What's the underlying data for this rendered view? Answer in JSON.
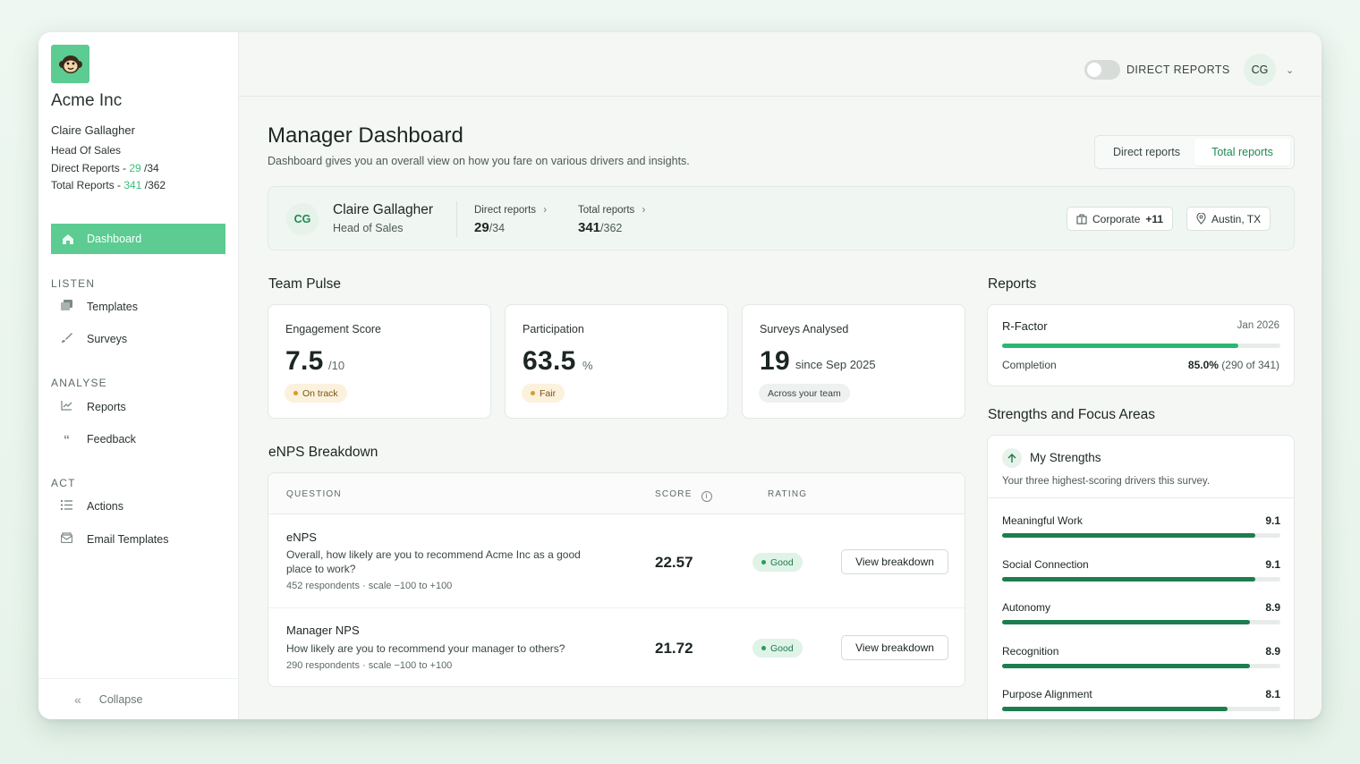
{
  "sidebar": {
    "company": "Acme Inc",
    "user_name": "Claire Gallagher",
    "user_role": "Head Of Sales",
    "direct_label": "Direct Reports - ",
    "direct_num": "29",
    "direct_total": " /34",
    "total_label": "Total Reports - ",
    "total_num": "341",
    "total_total": " /362",
    "active_item": "Dashboard",
    "sections": {
      "listen": "LISTEN",
      "analyse": "ANALYSE",
      "act": "ACT"
    },
    "items": {
      "templates": "Templates",
      "surveys": "Surveys",
      "reports": "Reports",
      "feedback": "Feedback",
      "actions": "Actions",
      "email_templates": "Email Templates"
    },
    "collapse": "Collapse"
  },
  "topbar": {
    "toggle_label": "DIRECT REPORTS",
    "avatar": "CG"
  },
  "page": {
    "title": "Manager Dashboard",
    "subtitle": "Dashboard gives you an overall view on how you fare on various drivers and insights.",
    "tabs": [
      "Direct reports",
      "Total reports"
    ]
  },
  "profile": {
    "initials": "CG",
    "name": "Claire Gallagher",
    "role": "Head of Sales",
    "direct_label": "Direct reports",
    "direct_value": "29",
    "direct_total": "/34",
    "total_label": "Total reports",
    "total_value": "341",
    "total_total": "/362",
    "chip_dept": "Corporate",
    "chip_dept_more": "+11",
    "chip_location": "Austin, TX"
  },
  "team_pulse": {
    "title": "Team Pulse",
    "cards": [
      {
        "label": "Engagement Score",
        "value": "7.5",
        "unit": "/10",
        "pill": "On track"
      },
      {
        "label": "Participation",
        "value": "63.5",
        "unit": "%",
        "pill": "Fair"
      },
      {
        "label": "Surveys Analysed",
        "value": "19",
        "unit": "since Sep 2025",
        "pill": "Across your team"
      }
    ]
  },
  "enps": {
    "title": "eNPS Breakdown",
    "headers": {
      "question": "QUESTION",
      "score": "SCORE",
      "rating": "RATING"
    },
    "rows": [
      {
        "title": "eNPS",
        "text": "Overall, how likely are you to recommend Acme Inc as a good place to work?",
        "meta": "452 respondents · scale −100 to +100",
        "score": "22.57",
        "rating": "Good",
        "action": "View breakdown"
      },
      {
        "title": "Manager NPS",
        "text": "How likely are you to recommend your manager to others?",
        "meta": "290 respondents · scale −100 to +100",
        "score": "21.72",
        "rating": "Good",
        "action": "View breakdown"
      }
    ]
  },
  "reports": {
    "title": "Reports",
    "rfactor_label": "R-Factor",
    "rfactor_date": "Jan 2026",
    "completion_label": "Completion",
    "completion_pct": "85.0%",
    "completion_detail": "(290 of 341)",
    "completion_fraction": 0.85
  },
  "strengths": {
    "title": "Strengths and Focus Areas",
    "card_title": "My Strengths",
    "card_sub": "Your three highest-scoring drivers this survey.",
    "drivers": [
      {
        "name": "Meaningful Work",
        "score": "9.1",
        "fraction": 0.91
      },
      {
        "name": "Social Connection",
        "score": "9.1",
        "fraction": 0.91
      },
      {
        "name": "Autonomy",
        "score": "8.9",
        "fraction": 0.89
      },
      {
        "name": "Recognition",
        "score": "8.9",
        "fraction": 0.89
      },
      {
        "name": "Purpose Alignment",
        "score": "8.1",
        "fraction": 0.81
      }
    ]
  },
  "colors": {
    "accent": "#5ccc92",
    "accent_dark": "#1f8a55",
    "bar": "#1d7d4e",
    "bar_completion": "#2bb673"
  }
}
